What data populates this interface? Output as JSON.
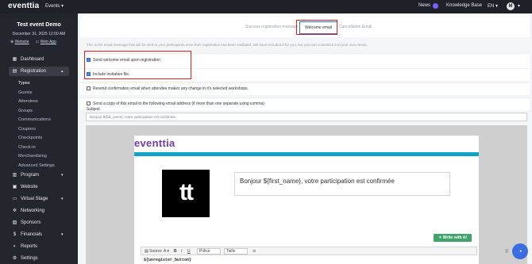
{
  "topbar": {
    "logo": "eventtia",
    "events_menu": "Events ▾",
    "news": "News",
    "knowledge_base": "Knowledge Base",
    "language": "EN ▾",
    "avatar_letter": "M",
    "avatar_caret": "▾"
  },
  "sidebar": {
    "event_title": "Test event Demo",
    "event_date": "December 31, 2025 12:00 AM",
    "website_link": "Website",
    "webapp_link": "Web App",
    "items": [
      {
        "label": "Dashboard",
        "icon": "▦"
      },
      {
        "label": "Registration",
        "icon": "▤",
        "chevron": "▴"
      },
      {
        "label": "Program",
        "icon": "▥",
        "chevron": "▾"
      },
      {
        "label": "Website",
        "icon": "▣"
      },
      {
        "label": "Virtual Stage",
        "icon": "▭",
        "chevron": "▾"
      },
      {
        "label": "Networking",
        "icon": "✲"
      },
      {
        "label": "Sponsors",
        "icon": "▨"
      },
      {
        "label": "Financials",
        "icon": "$",
        "chevron": "▾"
      },
      {
        "label": "Reports",
        "icon": "◐"
      },
      {
        "label": "Settings",
        "icon": "⚙"
      }
    ],
    "sub_items": [
      "Types",
      "Guests",
      "Attendees",
      "Groups",
      "Communications",
      "Coupons",
      "Checkpoints",
      "Check-in",
      "Merchandising",
      "Advanced Settings"
    ]
  },
  "main": {
    "inner_tabs": {
      "success": "Success registration message",
      "welcome": "Welcome email",
      "cancellation": "Cancellation Email"
    },
    "description": "This is the email message that will be sent to your participants once their registration has been validated. We have included it for you, but you can customize it to your own needs.",
    "options": {
      "send_welcome": "Send welcome email upon registration",
      "include_invitation": "Include invitation file.",
      "resend": "Resend confirmation email when attendee makes any change in it's selected workshops.",
      "send_copy": "Send a copy of this email to the following email address (if more than one separate using comma)"
    },
    "subject_label": "Subject",
    "subject_value": "Bonjour ${full_name}, votre participation est confirmée"
  },
  "preview": {
    "logo": "eventtia",
    "tt_logo": "tt",
    "greeting": "Bonjour ${first_name}, votre participation est confirmée",
    "ai_button": "✦ Write with AI",
    "toolbar": {
      "source": "▤ Source",
      "font_color": "A ▾",
      "bold": "B",
      "italic": "I",
      "underline": "U",
      "font": "Police",
      "size": "Taille",
      "link": "⊝"
    },
    "editor_text": "${unregister_button}"
  },
  "chat_icon": "◔"
}
